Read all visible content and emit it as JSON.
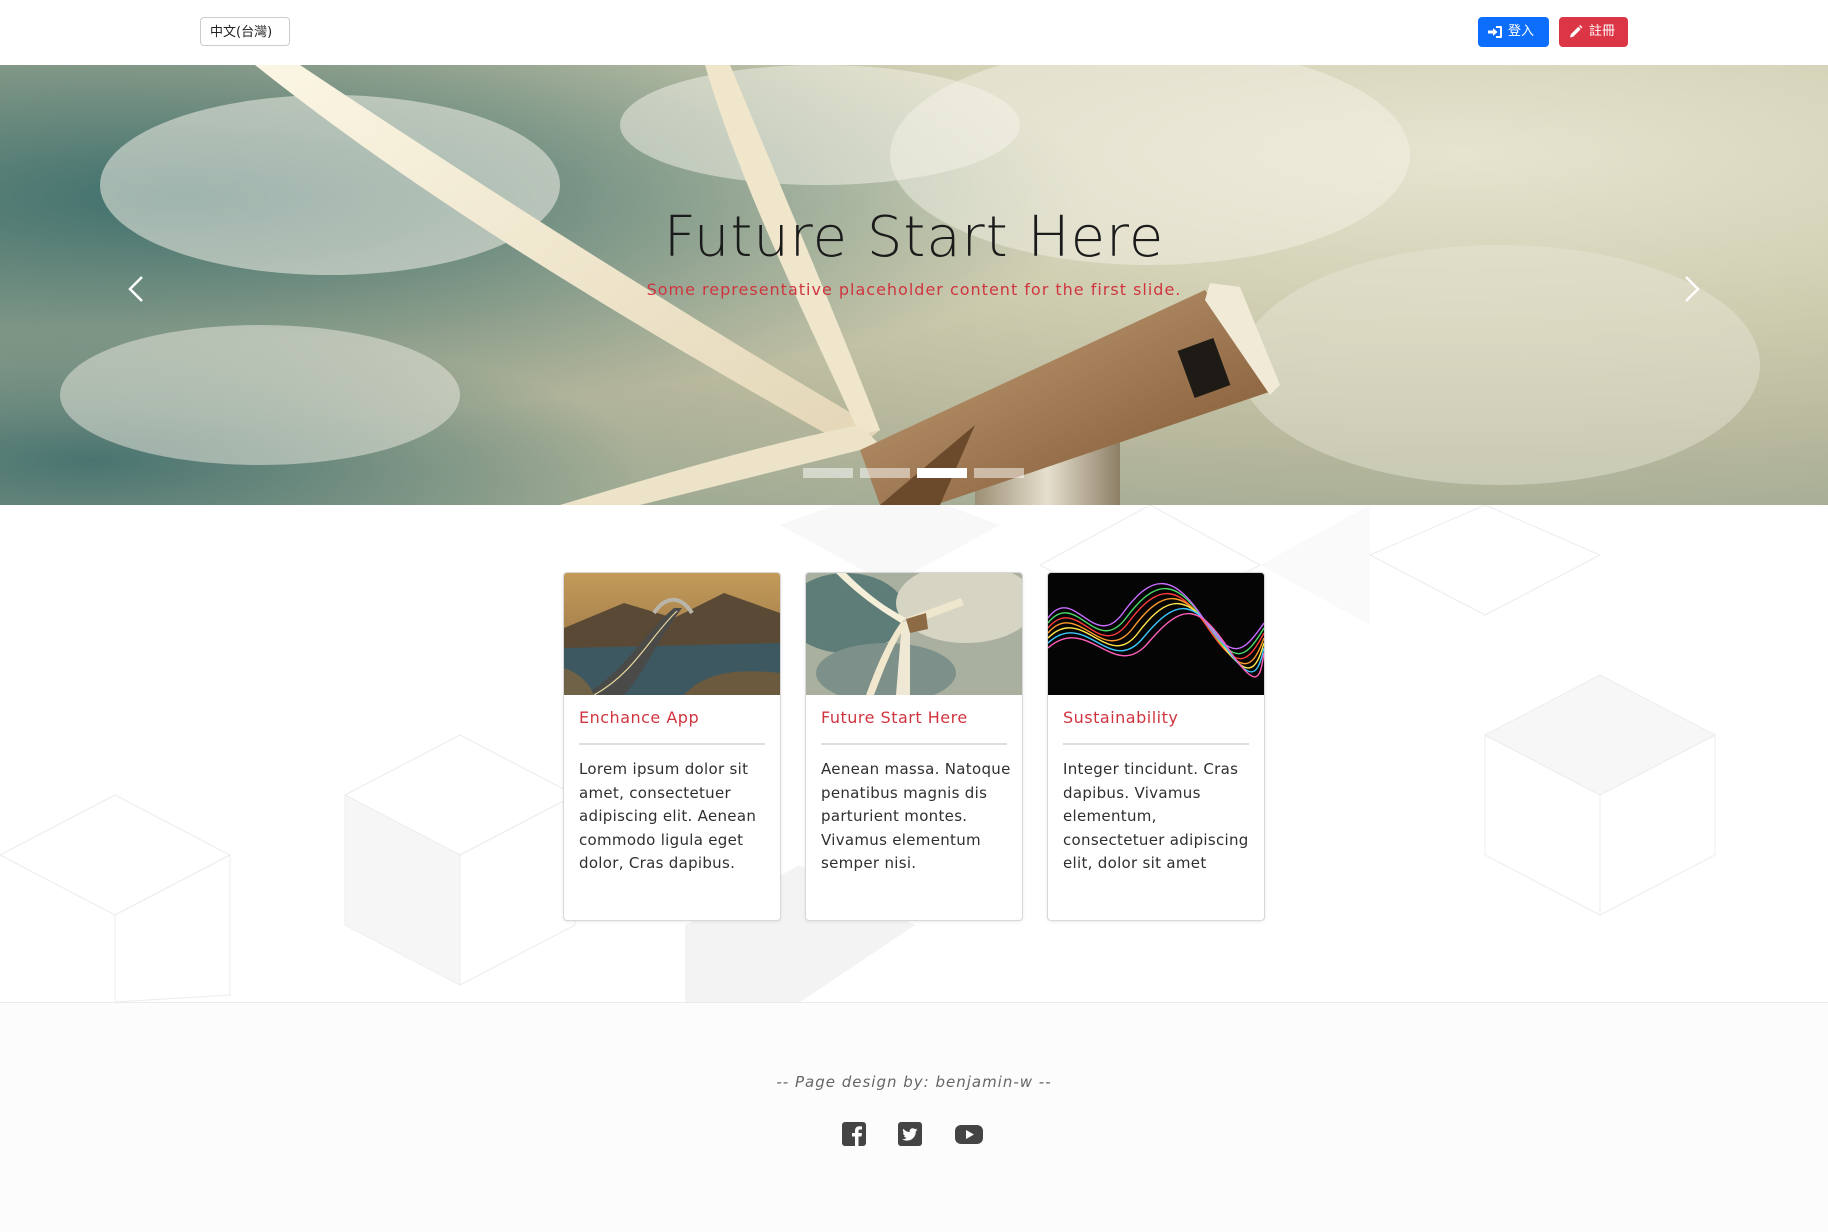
{
  "header": {
    "language": "中文(台灣)",
    "login_label": "登入",
    "signup_label": "註冊",
    "login_color": "#0d6efd",
    "signup_color": "#dc3545"
  },
  "hero": {
    "title": "Future Start Here",
    "subtitle": "Some representative placeholder content for the first slide.",
    "slide_count": 4,
    "active_slide": 3
  },
  "cards": [
    {
      "image": "coastal-road-bridge-photo",
      "title": "Enchance App",
      "text": "Lorem ipsum dolor sit amet, consectetuer adipiscing elit. Aenean commodo ligula eget dolor, Cras dapibus."
    },
    {
      "image": "wind-turbine-photo",
      "title": "Future Start Here",
      "text": "Aenean massa. Natoque penatibus magnis dis parturient montes. Vivamus elementum semper nisi."
    },
    {
      "image": "colorful-light-waves-photo",
      "title": "Sustainability",
      "text": "Integer tincidunt. Cras dapibus. Vivamus elementum, consectetuer adipiscing elit, dolor sit amet"
    }
  ],
  "footer": {
    "credit": "-- Page design by: benjamin-w --",
    "social": [
      "facebook-icon",
      "twitter-icon",
      "youtube-icon"
    ]
  },
  "colors": {
    "accent_red": "#d0353f",
    "icon_gray": "#444444"
  }
}
